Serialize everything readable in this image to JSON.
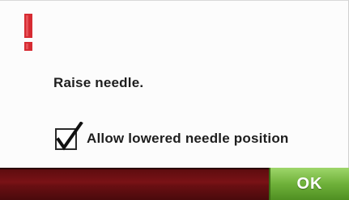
{
  "dialog": {
    "icon": "exclamation-icon",
    "message": "Raise needle.",
    "checkbox": {
      "label": "Allow lowered needle position",
      "checked": true
    },
    "ok_label": "OK"
  },
  "colors": {
    "warning": "#d62b32",
    "bar": "#6a0f12",
    "ok_button": "#6fb13a"
  }
}
